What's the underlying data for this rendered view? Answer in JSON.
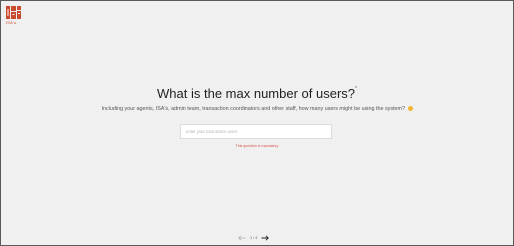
{
  "logo": {
    "text": "ISA's",
    "colors": {
      "primary": "#c94a2e",
      "light": "#ffffff"
    }
  },
  "question": {
    "title": "What is the max number of users?",
    "required_marker": "*",
    "subtitle": "Including your agents, ISA's, admin team, transaction coordinators and other staff, how many users might be using the system?",
    "emoji_icon": "thinking-face-icon"
  },
  "answer": {
    "placeholder": "enter your total active users",
    "value": ""
  },
  "validation": {
    "message": "This question is mandatory"
  },
  "pagination": {
    "counter": "1 / 4",
    "prev_icon": "arrow-left-icon",
    "next_icon": "arrow-right-icon"
  },
  "colors": {
    "background": "#f0f0f0",
    "error": "#d9534f",
    "title": "#1f1f1f"
  }
}
